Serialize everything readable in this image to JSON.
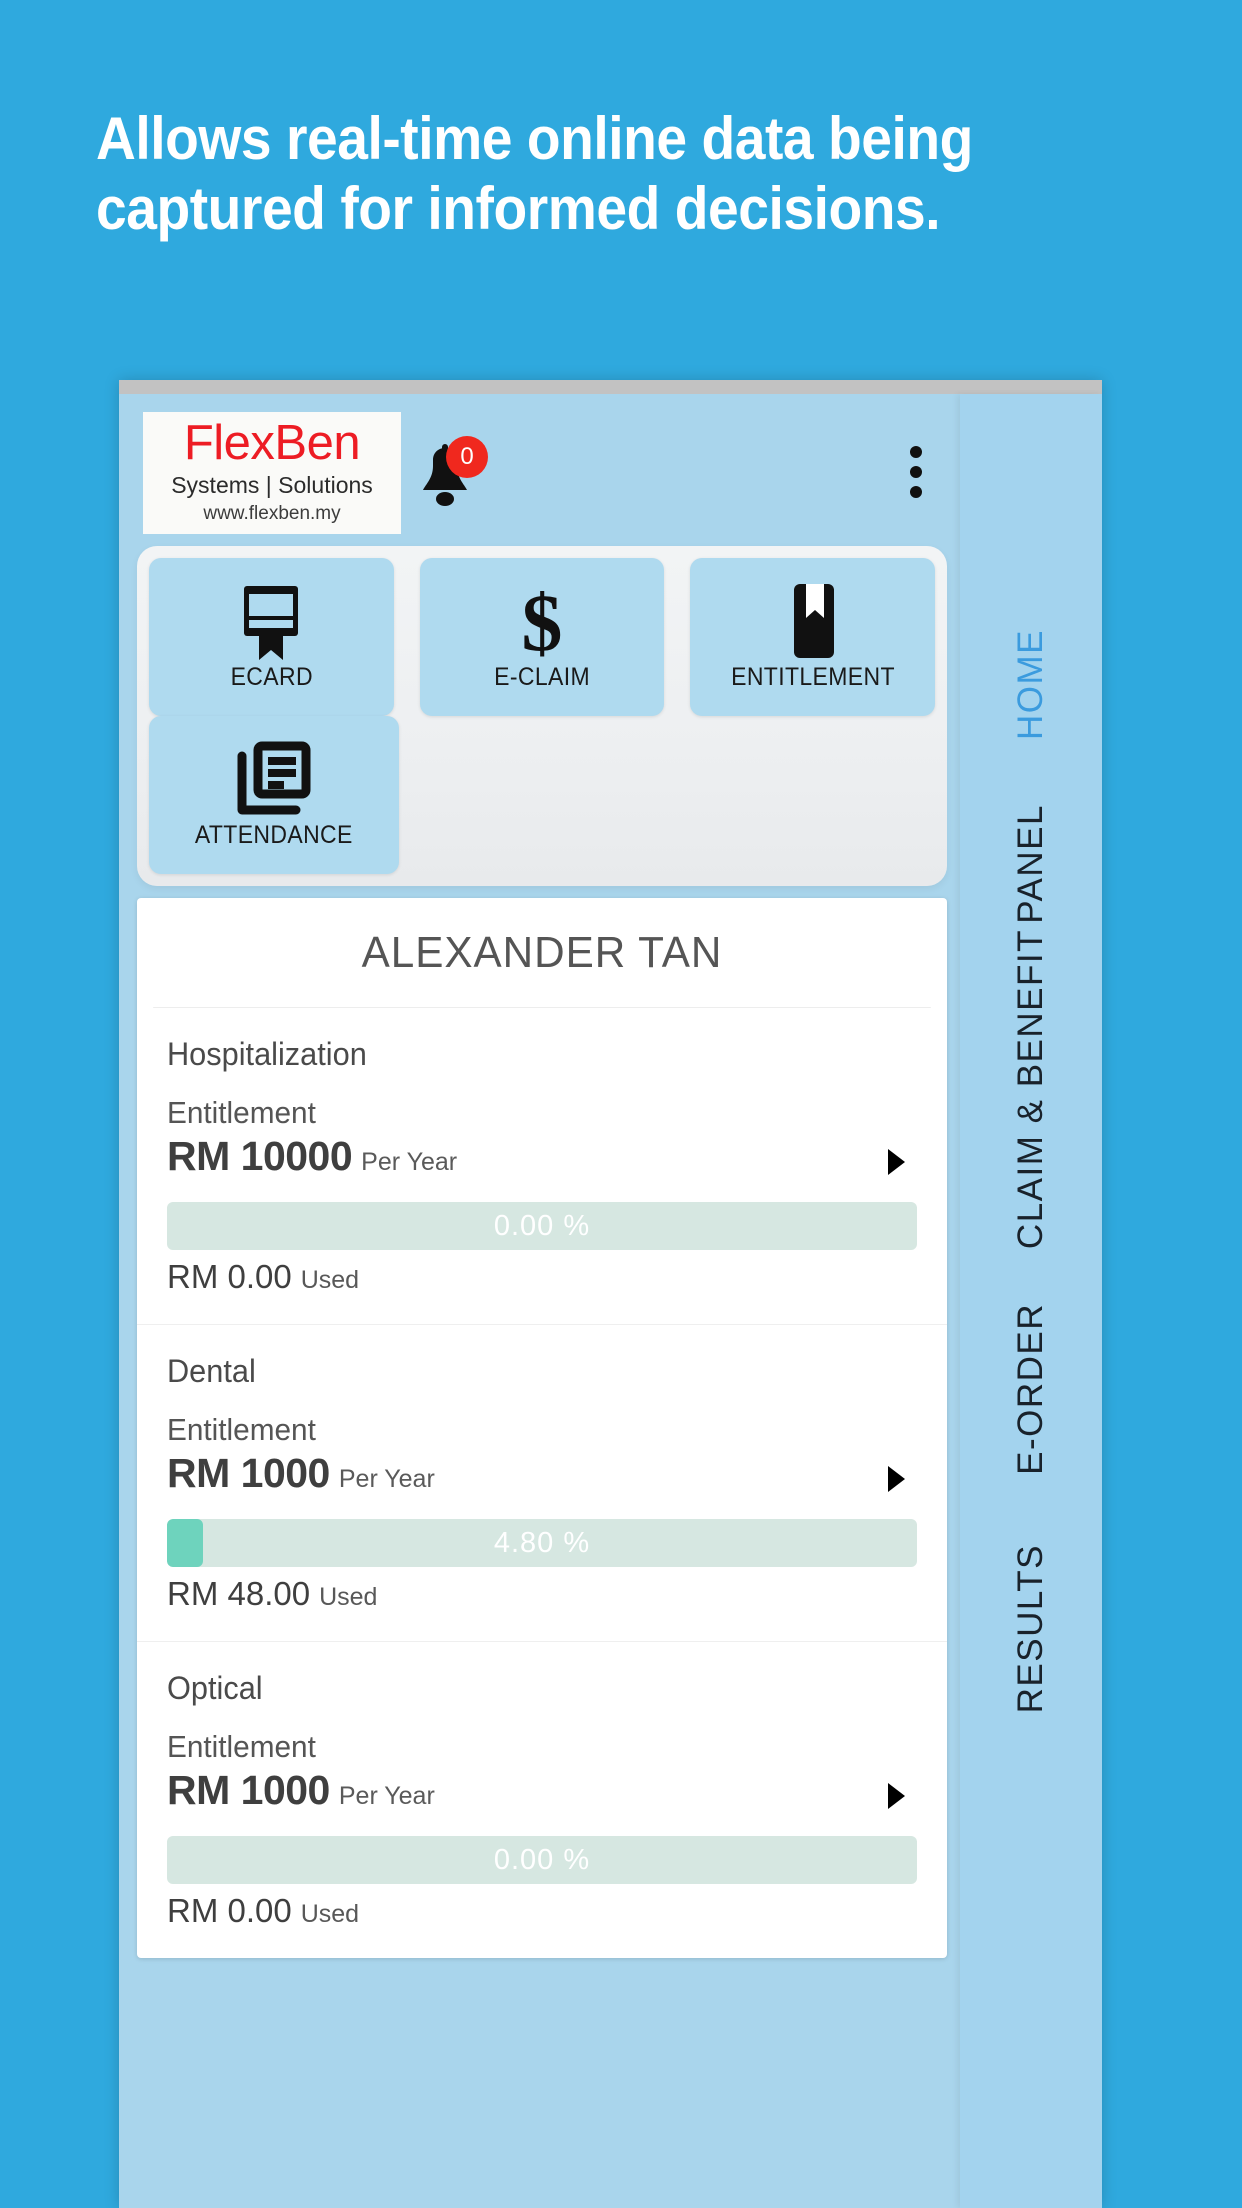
{
  "promo": {
    "headline_line1": "Allows real-time online data being",
    "headline_line2": "captured for informed decisions.",
    "background_color": "#2FA9DE",
    "text_color": "#FFFFFF"
  },
  "app": {
    "logo": {
      "brand": "FlexBen",
      "tagline": "Systems | Solutions",
      "url": "www.flexben.my",
      "brand_color": "#ED1C24"
    },
    "notifications": {
      "icon": "bell-icon",
      "badge_count": "0",
      "badge_color": "#F0281E"
    },
    "overflow_menu": {
      "icon": "kebab-menu-icon"
    },
    "quick_tiles": [
      {
        "label": "ECARD",
        "icon": "card-bookmark-icon"
      },
      {
        "label": "E-CLAIM",
        "icon": "dollar-sign-icon"
      },
      {
        "label": "ENTITLEMENT",
        "icon": "book-bookmark-icon"
      },
      {
        "label": "ATTENDANCE",
        "icon": "document-list-icon"
      }
    ],
    "employee": {
      "name": "ALEXANDER TAN"
    },
    "benefits": [
      {
        "name": "Hospitalization",
        "entitlement_label": "Entitlement",
        "amount": "RM 10000",
        "period": "Per Year",
        "percent_text": "0.00 %",
        "percent_value": 0.0,
        "used_amount": "RM 0.00",
        "used_label": "Used"
      },
      {
        "name": "Dental",
        "entitlement_label": "Entitlement",
        "amount": "RM 1000",
        "period": "Per Year",
        "percent_text": "4.80 %",
        "percent_value": 4.8,
        "used_amount": "RM 48.00",
        "used_label": "Used"
      },
      {
        "name": "Optical",
        "entitlement_label": "Entitlement",
        "amount": "RM 1000",
        "period": "Per Year",
        "percent_text": "0.00 %",
        "percent_value": 0.0,
        "used_amount": "RM 0.00",
        "used_label": "Used"
      }
    ],
    "tabs": [
      {
        "label": "HOME",
        "active": true
      },
      {
        "label": "PANEL",
        "active": false
      },
      {
        "label": "CLAIM & BENEFIT",
        "active": false
      },
      {
        "label": "E-ORDER",
        "active": false
      },
      {
        "label": "RESULTS",
        "active": false
      }
    ],
    "accent_color": "#3B9BDE",
    "progress_fill_color": "#6ED3BD",
    "progress_track_color": "#D6E7E1"
  }
}
